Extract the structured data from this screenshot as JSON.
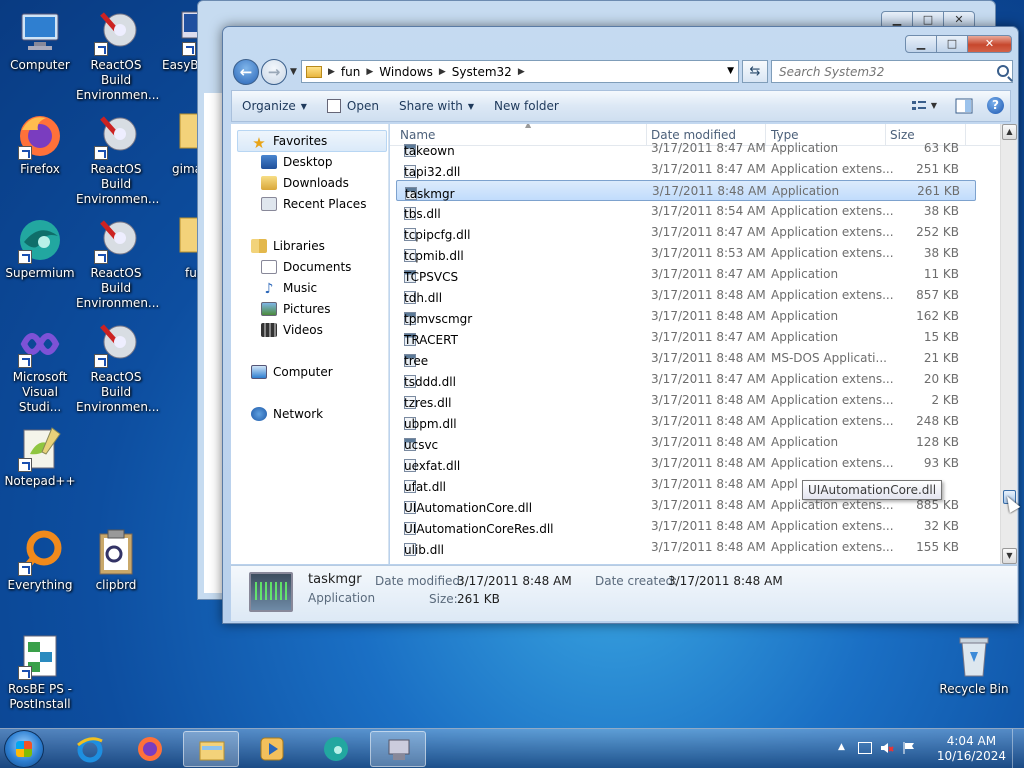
{
  "desktop": {
    "icons": [
      {
        "label": "Computer"
      },
      {
        "label": "ReactOS Build Environmen..."
      },
      {
        "label": "EasyBC"
      },
      {
        "label": "Firefox"
      },
      {
        "label": "ReactOS Build Environmen..."
      },
      {
        "label": "gima"
      },
      {
        "label": "Supermium"
      },
      {
        "label": "ReactOS Build Environmen..."
      },
      {
        "label": "fu"
      },
      {
        "label": "Microsoft Visual Studi..."
      },
      {
        "label": "ReactOS Build Environmen..."
      },
      {
        "label": "Notepad++"
      },
      {
        "label": "Everything"
      },
      {
        "label": "clipbrd"
      },
      {
        "label": "RosBE PS - PostInstall"
      },
      {
        "label": "Recycle Bin"
      }
    ]
  },
  "window": {
    "caption": {
      "min": "▁",
      "max": "□",
      "close": "✕"
    },
    "address": {
      "crumbs": [
        "fun",
        "Windows",
        "System32"
      ]
    },
    "search_placeholder": "Search System32",
    "toolbar": {
      "organize": "Organize",
      "open": "Open",
      "share_with": "Share with",
      "new_folder": "New folder",
      "help": "?"
    },
    "nav": {
      "favorites": "Favorites",
      "desktop": "Desktop",
      "downloads": "Downloads",
      "recent_places": "Recent Places",
      "libraries": "Libraries",
      "documents": "Documents",
      "music": "Music",
      "pictures": "Pictures",
      "videos": "Videos",
      "computer": "Computer",
      "network": "Network"
    },
    "columns": {
      "name": "Name",
      "date": "Date modified",
      "type": "Type",
      "size": "Size"
    },
    "files": [
      {
        "name": "takeown",
        "date": "3/17/2011 8:47 AM",
        "type": "Application",
        "size": "63 KB",
        "app": true
      },
      {
        "name": "tapi32.dll",
        "date": "3/17/2011 8:47 AM",
        "type": "Application extens...",
        "size": "251 KB",
        "app": false
      },
      {
        "name": "taskmgr",
        "date": "3/17/2011 8:48 AM",
        "type": "Application",
        "size": "261 KB",
        "app": true
      },
      {
        "name": "tbs.dll",
        "date": "3/17/2011 8:54 AM",
        "type": "Application extens...",
        "size": "38 KB",
        "app": false
      },
      {
        "name": "tcpipcfg.dll",
        "date": "3/17/2011 8:47 AM",
        "type": "Application extens...",
        "size": "252 KB",
        "app": false
      },
      {
        "name": "tcpmib.dll",
        "date": "3/17/2011 8:53 AM",
        "type": "Application extens...",
        "size": "38 KB",
        "app": false
      },
      {
        "name": "TCPSVCS",
        "date": "3/17/2011 8:47 AM",
        "type": "Application",
        "size": "11 KB",
        "app": true
      },
      {
        "name": "tdh.dll",
        "date": "3/17/2011 8:48 AM",
        "type": "Application extens...",
        "size": "857 KB",
        "app": false
      },
      {
        "name": "tpmvscmgr",
        "date": "3/17/2011 8:48 AM",
        "type": "Application",
        "size": "162 KB",
        "app": true
      },
      {
        "name": "TRACERT",
        "date": "3/17/2011 8:47 AM",
        "type": "Application",
        "size": "15 KB",
        "app": true
      },
      {
        "name": "tree",
        "date": "3/17/2011 8:48 AM",
        "type": "MS-DOS Applicati...",
        "size": "21 KB",
        "app": true
      },
      {
        "name": "tsddd.dll",
        "date": "3/17/2011 8:47 AM",
        "type": "Application extens...",
        "size": "20 KB",
        "app": false
      },
      {
        "name": "tzres.dll",
        "date": "3/17/2011 8:48 AM",
        "type": "Application extens...",
        "size": "2 KB",
        "app": false
      },
      {
        "name": "ubpm.dll",
        "date": "3/17/2011 8:48 AM",
        "type": "Application extens...",
        "size": "248 KB",
        "app": false
      },
      {
        "name": "ucsvc",
        "date": "3/17/2011 8:48 AM",
        "type": "Application",
        "size": "128 KB",
        "app": true
      },
      {
        "name": "uexfat.dll",
        "date": "3/17/2011 8:48 AM",
        "type": "Application extens...",
        "size": "93 KB",
        "app": false
      },
      {
        "name": "ufat.dll",
        "date": "3/17/2011 8:48 AM",
        "type": "Appl",
        "size": "",
        "app": false
      },
      {
        "name": "UIAutomationCore.dll",
        "date": "3/17/2011 8:48 AM",
        "type": "Application extens...",
        "size": "885 KB",
        "app": false
      },
      {
        "name": "UIAutomationCoreRes.dll",
        "date": "3/17/2011 8:48 AM",
        "type": "Application extens...",
        "size": "32 KB",
        "app": false
      },
      {
        "name": "ulib.dll",
        "date": "3/17/2011 8:48 AM",
        "type": "Application extens...",
        "size": "155 KB",
        "app": false
      }
    ],
    "selected_index": 2,
    "tooltip": "UIAutomationCore.dll",
    "details": {
      "name": "taskmgr",
      "type": "Application",
      "date_modified_label": "Date modified:",
      "date_modified": "3/17/2011 8:48 AM",
      "date_created_label": "Date created:",
      "date_created": "3/17/2011 8:48 AM",
      "size_label": "Size:",
      "size": "261 KB"
    }
  },
  "taskbar": {
    "time": "4:04 AM",
    "date": "10/16/2024"
  },
  "colors": {
    "accent": "#1a6fc4",
    "selection": "#c1dcfc"
  }
}
